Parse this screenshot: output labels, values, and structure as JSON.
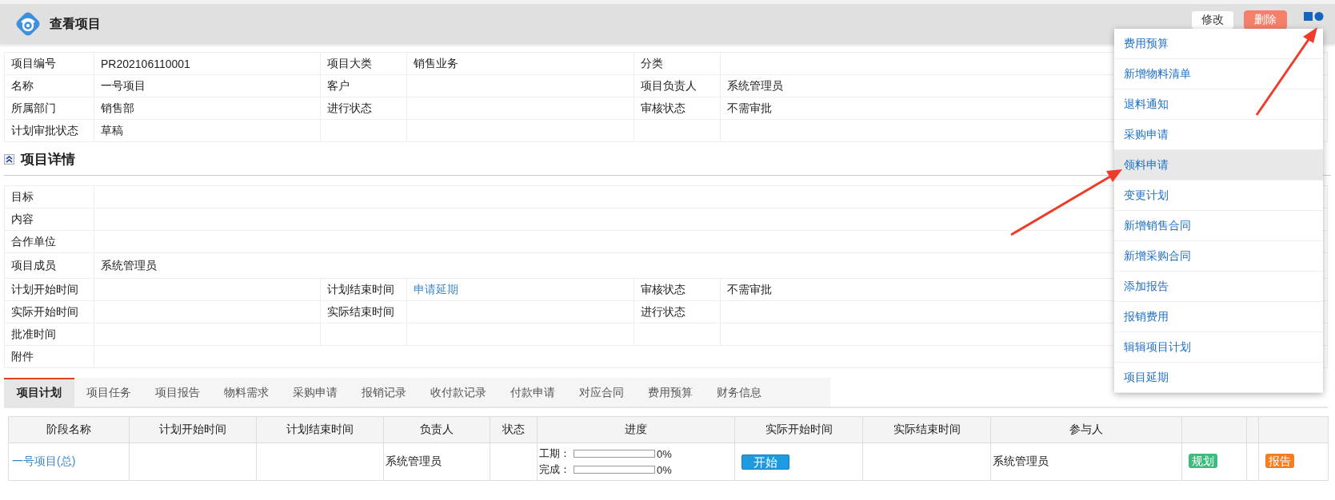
{
  "header": {
    "title": "查看项目",
    "buttons": [
      {
        "label": "修改",
        "kind": "default"
      },
      {
        "label": "删除",
        "kind": "danger"
      }
    ]
  },
  "info": {
    "rows": [
      [
        {
          "label": "项目编号",
          "value": "PR202106110001"
        },
        {
          "label": "项目大类",
          "value": "销售业务"
        },
        {
          "label": "分类"
        }
      ],
      [
        {
          "label": "名称",
          "value": "一号项目"
        },
        {
          "label": "客户"
        },
        {
          "label": "项目负责人",
          "value": "系统管理员"
        }
      ],
      [
        {
          "label": "所属部门",
          "value": "销售部"
        },
        {
          "label": "进行状态"
        },
        {
          "label": "审核状态",
          "value": "不需审批"
        }
      ],
      [
        {
          "label": "计划审批状态",
          "value": "草稿"
        },
        {},
        {}
      ]
    ]
  },
  "details": {
    "title": "项目详情",
    "rows": [
      {
        "kind": "wide",
        "label": "目标"
      },
      {
        "kind": "wide",
        "label": "内容"
      },
      {
        "kind": "wide",
        "label": "合作单位"
      },
      {
        "kind": "wide",
        "label": "项目成员",
        "value": "系统管理员"
      },
      {
        "kind": "triple",
        "cells": [
          {
            "label": "计划开始时间"
          },
          {
            "label": "计划结束时间",
            "link": "申请延期"
          },
          {
            "label": "审核状态",
            "value": "不需审批"
          }
        ]
      },
      {
        "kind": "triple",
        "cells": [
          {
            "label": "实际开始时间"
          },
          {
            "label": "实际结束时间"
          },
          {
            "label": "进行状态"
          }
        ]
      },
      {
        "kind": "triple",
        "cells": [
          {
            "label": "批准时间"
          },
          {},
          {}
        ]
      },
      {
        "kind": "wide",
        "label": "附件"
      }
    ]
  },
  "tabs": [
    {
      "label": "项目计划",
      "selected": true
    },
    {
      "label": "项目任务",
      "selected": false
    },
    {
      "label": "项目报告",
      "selected": false
    },
    {
      "label": "物料需求",
      "selected": false
    },
    {
      "label": "采购申请",
      "selected": false
    },
    {
      "label": "报销记录",
      "selected": false
    },
    {
      "label": "收付款记录",
      "selected": false
    },
    {
      "label": "付款申请",
      "selected": false
    },
    {
      "label": "对应合同",
      "selected": false
    },
    {
      "label": "费用预算",
      "selected": false
    },
    {
      "label": "财务信息",
      "selected": false
    }
  ],
  "plan_table": {
    "columns": [
      {
        "label": "阶段名称"
      },
      {
        "label": "计划开始时间"
      },
      {
        "label": "计划结束时间"
      },
      {
        "label": "负责人"
      },
      {
        "label": "状态"
      },
      {
        "label": "进度"
      },
      {
        "label": "实际开始时间"
      },
      {
        "label": "实际结束时间"
      },
      {
        "label": "参与人"
      },
      {},
      {},
      {}
    ],
    "rows": [
      {
        "cells": [
          {
            "kind": "link",
            "text": "一号项目(总)"
          },
          {
            "kind": "empty"
          },
          {
            "kind": "empty"
          },
          {
            "kind": "text",
            "text": "系统管理员"
          },
          {
            "kind": "empty"
          },
          {
            "kind": "progress",
            "bars": [
              {
                "label": "工期：",
                "level": 0,
                "reading": "0%"
              },
              {
                "label": "完成：",
                "level": 0,
                "reading": "0%"
              }
            ]
          },
          {
            "kind": "button",
            "text": "开始"
          },
          {
            "kind": "empty"
          },
          {
            "kind": "text",
            "text": "系统管理员"
          },
          {
            "kind": "tag",
            "text": "规划",
            "color": "#3dbd7d"
          },
          {
            "kind": "empty"
          },
          {
            "kind": "tag",
            "text": "报告",
            "color": "#f57c1f"
          }
        ]
      }
    ]
  },
  "menu": {
    "items": [
      {
        "label": "费用预算",
        "selected": false
      },
      {
        "label": "新增物料清单",
        "selected": false
      },
      {
        "label": "退料通知",
        "selected": false
      },
      {
        "label": "采购申请",
        "selected": false
      },
      {
        "label": "领料申请",
        "selected": true
      },
      {
        "label": "变更计划",
        "selected": false
      },
      {
        "label": "新增销售合同",
        "selected": false
      },
      {
        "label": "新增采购合同",
        "selected": false
      },
      {
        "label": "添加报告",
        "selected": false
      },
      {
        "label": "报销费用",
        "selected": false
      },
      {
        "label": "辑辑项目计划",
        "selected": false
      },
      {
        "label": "项目延期",
        "selected": false
      }
    ]
  }
}
